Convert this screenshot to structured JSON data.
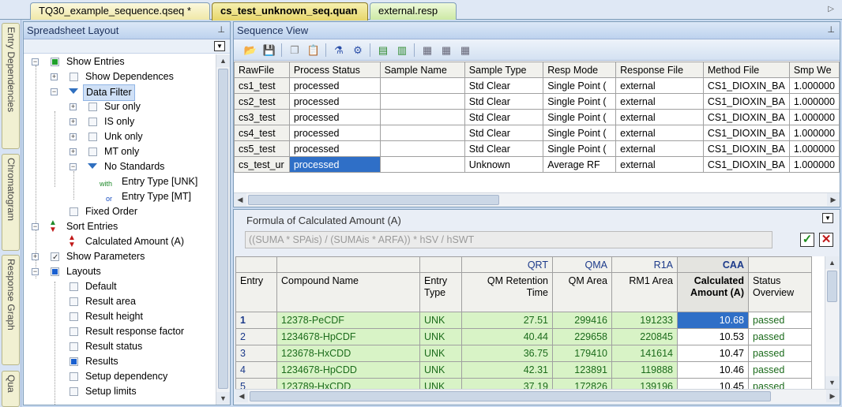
{
  "doc_tabs": [
    "TQ30_example_sequence.qseq *",
    "cs_test_unknown_seq.quan",
    "external.resp"
  ],
  "side_tabs": [
    "Entry Dependencies",
    "Chromatogram",
    "Response Graph",
    "Qua"
  ],
  "layout_panel": {
    "title": "Spreadsheet Layout",
    "tree": {
      "show_entries": "Show Entries",
      "show_dependences": "Show Dependences",
      "data_filter": "Data Filter",
      "sur_only": "Sur only",
      "is_only": "IS only",
      "unk_only": "Unk only",
      "mt_only": "MT only",
      "no_standards": "No Standards",
      "with_prefix": "with",
      "or_prefix": "or",
      "entry_type_unk": "Entry Type [UNK]",
      "entry_type_mt": "Entry Type [MT]",
      "fixed_order": "Fixed Order",
      "sort_entries": "Sort Entries",
      "calculated_amount": "Calculated Amount (A)",
      "show_parameters": "Show Parameters",
      "layouts": "Layouts",
      "default": "Default",
      "result_area": "Result area",
      "result_height": "Result height",
      "result_response_factor": "Result response factor",
      "result_status": "Result status",
      "results": "Results",
      "setup_dependency": "Setup dependency",
      "setup_limits": "Setup limits"
    }
  },
  "sequence_view": {
    "title": "Sequence View",
    "columns": [
      "RawFile",
      "Process Status",
      "Sample Name",
      "Sample Type",
      "Resp Mode",
      "Response File",
      "Method File",
      "Smp We"
    ],
    "rows": [
      [
        "cs1_test",
        "processed",
        "",
        "Std Clear",
        "Single Point (",
        "external",
        "CS1_DIOXIN_BA",
        "1.000000"
      ],
      [
        "cs2_test",
        "processed",
        "",
        "Std Clear",
        "Single Point (",
        "external",
        "CS1_DIOXIN_BA",
        "1.000000"
      ],
      [
        "cs3_test",
        "processed",
        "",
        "Std Clear",
        "Single Point (",
        "external",
        "CS1_DIOXIN_BA",
        "1.000000"
      ],
      [
        "cs4_test",
        "processed",
        "",
        "Std Clear",
        "Single Point (",
        "external",
        "CS1_DIOXIN_BA",
        "1.000000"
      ],
      [
        "cs5_test",
        "processed",
        "",
        "Std Clear",
        "Single Point (",
        "external",
        "CS1_DIOXIN_BA",
        "1.000000"
      ],
      [
        "cs_test_ur",
        "processed",
        "",
        "Unknown",
        "Average RF",
        "external",
        "CS1_DIOXIN_BA",
        "1.000000"
      ]
    ]
  },
  "formula": {
    "label": "Formula of Calculated Amount (A)",
    "value": "((SUMA * SPAis) / (SUMAis * ARFA)) * hSV / hSWT"
  },
  "results": {
    "abbr": [
      "",
      "",
      "",
      "QRT",
      "QMA",
      "R1A",
      "CAA",
      ""
    ],
    "headers": [
      "Entry",
      "Compound Name",
      "Entry Type",
      "QM Retention Time",
      "QM Area",
      "RM1 Area",
      "Calculated Amount (A)",
      "Status Overview"
    ],
    "rows": [
      [
        "1",
        "12378-PeCDF",
        "UNK",
        "27.51",
        "299416",
        "191233",
        "10.68",
        "passed"
      ],
      [
        "2",
        "1234678-HpCDF",
        "UNK",
        "40.44",
        "229658",
        "220845",
        "10.53",
        "passed"
      ],
      [
        "3",
        "123678-HxCDD",
        "UNK",
        "36.75",
        "179410",
        "141614",
        "10.47",
        "passed"
      ],
      [
        "4",
        "1234678-HpCDD",
        "UNK",
        "42.31",
        "123891",
        "119888",
        "10.46",
        "passed"
      ],
      [
        "5",
        "123789-HxCDD",
        "UNK",
        "37.19",
        "172826",
        "139196",
        "10.45",
        "passed"
      ]
    ]
  }
}
